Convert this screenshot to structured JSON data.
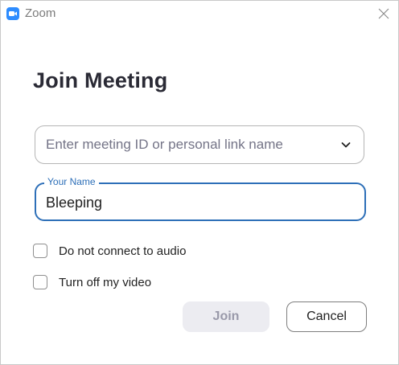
{
  "window": {
    "title": "Zoom",
    "app_icon": "zoom-camera-icon",
    "close_icon": "close-icon"
  },
  "main": {
    "heading": "Join Meeting",
    "meeting_id": {
      "placeholder": "Enter meeting ID or personal link name",
      "value": "",
      "dropdown_icon": "chevron-down-icon"
    },
    "name": {
      "label": "Your Name",
      "value": "Bleeping"
    },
    "options": [
      {
        "label": "Do not connect to audio",
        "checked": false
      },
      {
        "label": "Turn off my video",
        "checked": false
      }
    ]
  },
  "buttons": {
    "join": "Join",
    "cancel": "Cancel"
  },
  "colors": {
    "accent": "#2d6fb8",
    "app_icon": "#2d8cff",
    "heading": "#2a2a35",
    "join_disabled_bg": "#ececf1",
    "join_disabled_text": "#9a9aaa"
  }
}
